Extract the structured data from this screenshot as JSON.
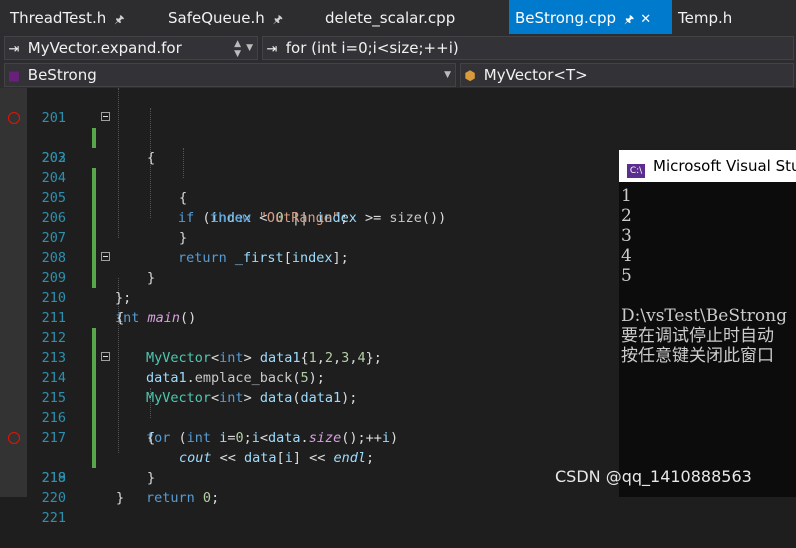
{
  "tabs": [
    {
      "label": "ThreadTest.h",
      "pin": "🖈"
    },
    {
      "label": "SafeQueue.h",
      "pin": "🖈"
    },
    {
      "label": "delete_scalar.cpp"
    },
    {
      "label": "BeStrong.cpp",
      "pin": "🖈",
      "close": "✕",
      "active": true
    },
    {
      "label": "Temp.h"
    }
  ],
  "nav": {
    "scope": "MyVector.expand.for",
    "member": "for (int i=0;i<size;++i)",
    "project": "BeStrong",
    "class": "MyVector<T>"
  },
  "lines": [
    {
      "n": "201",
      "code": "{"
    },
    {
      "n": "202",
      "code": "if (index < 0 || index >= size())",
      "breakpoint": true
    },
    {
      "n": "203",
      "code": "{"
    },
    {
      "n": "204",
      "code": "throw \"OutRange\";"
    },
    {
      "n": "205",
      "code": "}"
    },
    {
      "n": "206",
      "code": "return _first[index];"
    },
    {
      "n": "207",
      "code": "}"
    },
    {
      "n": "208",
      "code": "};"
    },
    {
      "n": "209",
      "code": "int main()"
    },
    {
      "n": "210",
      "code": "{"
    },
    {
      "n": "211",
      "code": "MyVector<int> data1{1,2,3,4};"
    },
    {
      "n": "212",
      "code": "data1.emplace_back(5);"
    },
    {
      "n": "213",
      "code": "MyVector<int> data(data1);"
    },
    {
      "n": "214",
      "code": "for (int i=0;i<data.size();++i)"
    },
    {
      "n": "215",
      "code": "{"
    },
    {
      "n": "216",
      "code": "cout << data[i] << endl;"
    },
    {
      "n": "217",
      "code": "}"
    },
    {
      "n": "218",
      "code": "return 0;",
      "breakpoint": true
    },
    {
      "n": "219",
      "code": "}"
    },
    {
      "n": "220",
      "code": ""
    },
    {
      "n": "221",
      "code": ""
    }
  ],
  "console": {
    "title": "Microsoft Visual Stu",
    "icon": "C:\\",
    "lines": [
      "1",
      "2",
      "3",
      "4",
      "5",
      "",
      "D:\\vsTest\\BeStrong",
      "要在调试停止时自动",
      "按任意键关闭此窗口"
    ]
  },
  "watermark": "CSDN @qq_1410888563",
  "colors": {
    "accent": "#007acc",
    "breakpoint": "#e51400",
    "line_number": "#2b91af",
    "keyword": "#569cd6",
    "type": "#4ec9b0",
    "string": "#d69d85"
  }
}
